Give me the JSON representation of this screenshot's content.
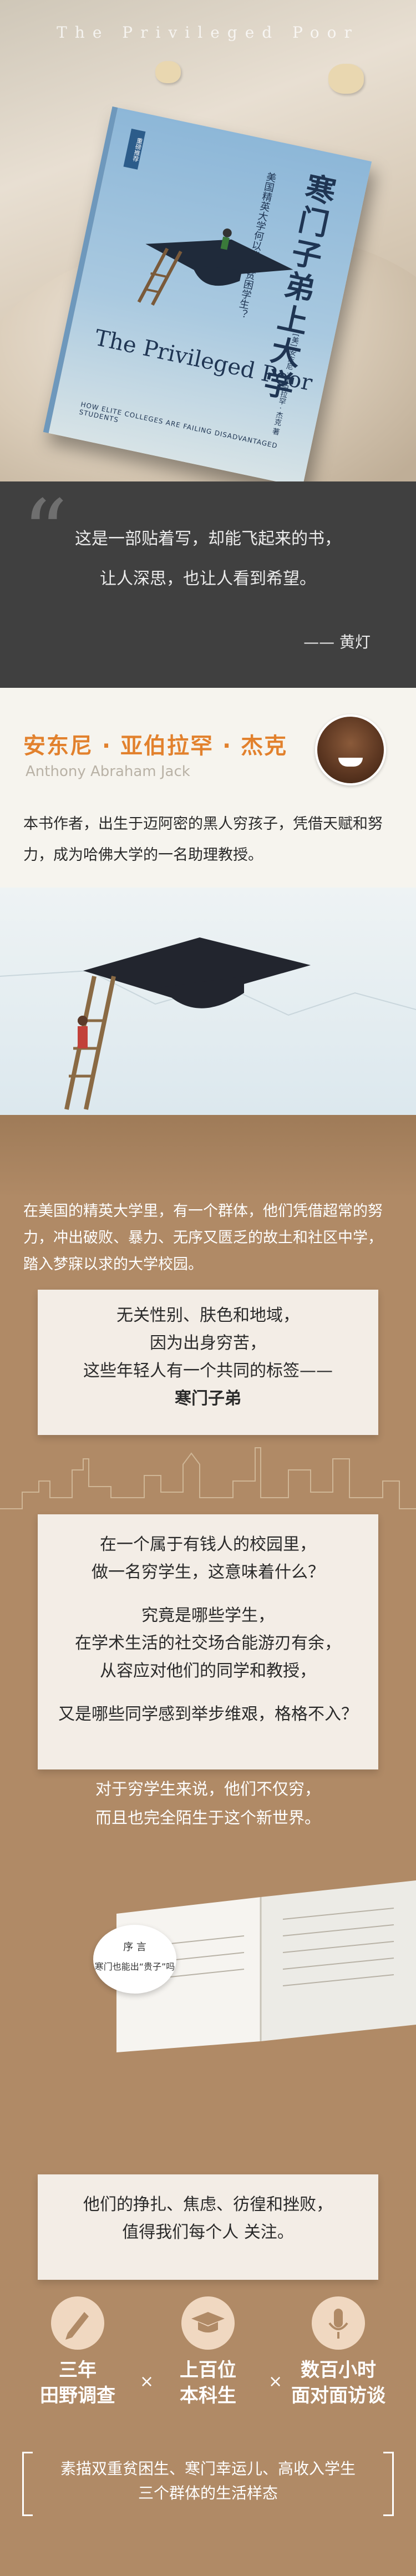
{
  "hero": {
    "top_text": "The Privileged Poor",
    "book": {
      "title_cn": "寒门子弟上大学",
      "subtitle_cn": "美国精英大学何以背弃贫困学生？",
      "badge": "重磅推荐",
      "title_en": "The Privileged Poor",
      "subtitle_en": "HOW ELITE COLLEGES ARE FAILING DISADVANTAGED STUDENTS",
      "author_line": "[美] 安东尼 · 亚伯拉罕 · 杰克 著"
    }
  },
  "quote": {
    "mark": "“",
    "line1": "这是一部贴着写，却能飞起来的书，",
    "line2": "让人深思，也让人看到希望。",
    "author": "—— 黄灯"
  },
  "author": {
    "name_cn": "安东尼 · 亚伯拉罕 · 杰克",
    "name_en": "Anthony Abraham Jack",
    "bio": "本书作者，出生于迈阿密的黑人穷孩子，凭借天赋和努力，成为哈佛大学的一名助理教授。"
  },
  "section": {
    "intro": "在美国的精英大学里，有一个群体，他们凭借超常的努力，冲出破败、暴力、无序又匮乏的故土和社区中学，踏入梦寐以求的大学校园。",
    "card1": {
      "line1": "无关性别、肤色和地域，",
      "line2": "因为出身穷苦，",
      "line3": "这些年轻人有一个共同的标签——",
      "line4": "寒门子弟"
    },
    "card2": {
      "q1a": "在一个属于有钱人的校园里，",
      "q1b": "做一名穷学生，这意味着什么？",
      "q2a": "究竟是哪些学生，",
      "q2b": "在学术生活的社交场合能游刃有余，",
      "q2c": "从容应对他们的同学和教授，",
      "q3": "又是哪些同学感到举步维艰，格格不入？"
    },
    "after1": "对于穷学生来说，他们不仅穷，",
    "after2": "而且也完全陌生于这个新世界。",
    "bubble_a": "序 言",
    "bubble_b": "寒门也能出“贵子”吗",
    "card3_line1": "他们的挣扎、焦虑、彷徨和挫败，",
    "card3_line2": "值得我们每个人 关注。",
    "stats": [
      {
        "a": "三年",
        "b": "田野调查",
        "icon": "pen-icon"
      },
      {
        "a": "上百位",
        "b": "本科生",
        "icon": "graduation-cap-icon"
      },
      {
        "a": "数百小时",
        "b": "面对面访谈",
        "icon": "microphone-icon"
      }
    ],
    "times": "×",
    "bracket1": "素描双重贫困生、寒门幸运儿、高收入学生",
    "bracket2": "三个群体的生活样态"
  }
}
